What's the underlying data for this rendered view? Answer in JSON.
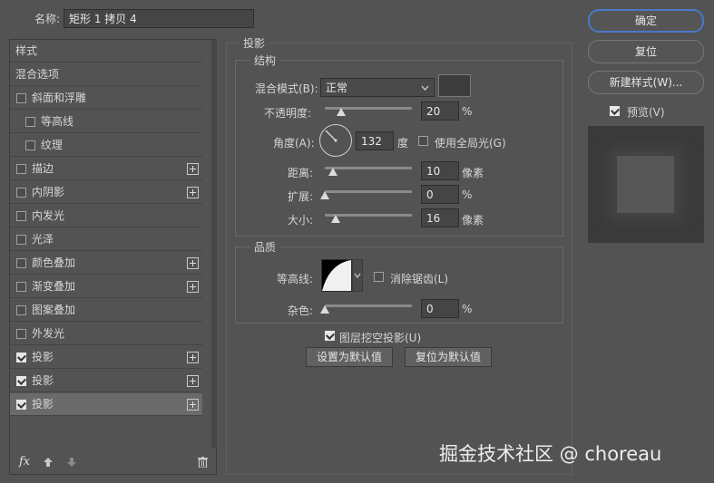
{
  "header": {
    "name_label": "名称:",
    "name_value": "矩形 1 拷贝 4"
  },
  "sidebar": {
    "items": [
      {
        "label": "样式"
      },
      {
        "label": "混合选项"
      },
      {
        "label": "斜面和浮雕"
      },
      {
        "label": "等高线"
      },
      {
        "label": "纹理"
      },
      {
        "label": "描边"
      },
      {
        "label": "内阴影"
      },
      {
        "label": "内发光"
      },
      {
        "label": "光泽"
      },
      {
        "label": "颜色叠加"
      },
      {
        "label": "渐变叠加"
      },
      {
        "label": "图案叠加"
      },
      {
        "label": "外发光"
      },
      {
        "label": "投影"
      },
      {
        "label": "投影"
      },
      {
        "label": "投影"
      }
    ],
    "fx_label": "fx"
  },
  "panel": {
    "title": "投影",
    "structure": {
      "legend": "结构",
      "blend_mode_label": "混合模式(B):",
      "blend_mode_value": "正常",
      "opacity_label": "不透明度:",
      "opacity_value": "20",
      "opacity_unit": "%",
      "opacity_fraction": 0.2,
      "angle_label": "角度(A):",
      "angle_value": "132",
      "angle_unit": "度",
      "global_light_label": "使用全局光(G)",
      "distance_label": "距离:",
      "distance_value": "10",
      "distance_unit": "像素",
      "spread_label": "扩展:",
      "spread_value": "0",
      "spread_unit": "%",
      "size_label": "大小:",
      "size_value": "16",
      "size_unit": "像素",
      "shadow_color": "#3c3c3c"
    },
    "quality": {
      "legend": "品质",
      "contour_label": "等高线:",
      "antialias_label": "消除锯齿(L)",
      "noise_label": "杂色:",
      "noise_value": "0",
      "noise_unit": "%"
    },
    "knockout_label": "图层挖空投影(U)",
    "set_default_label": "设置为默认值",
    "reset_default_label": "复位为默认值"
  },
  "actions": {
    "ok_label": "确定",
    "reset_label": "复位",
    "new_style_label": "新建样式(W)...",
    "preview_label": "预览(V)"
  },
  "watermark": "掘金技术社区 @ choreau",
  "colors": {
    "background": "#535353",
    "accent": "#4a78c8"
  }
}
